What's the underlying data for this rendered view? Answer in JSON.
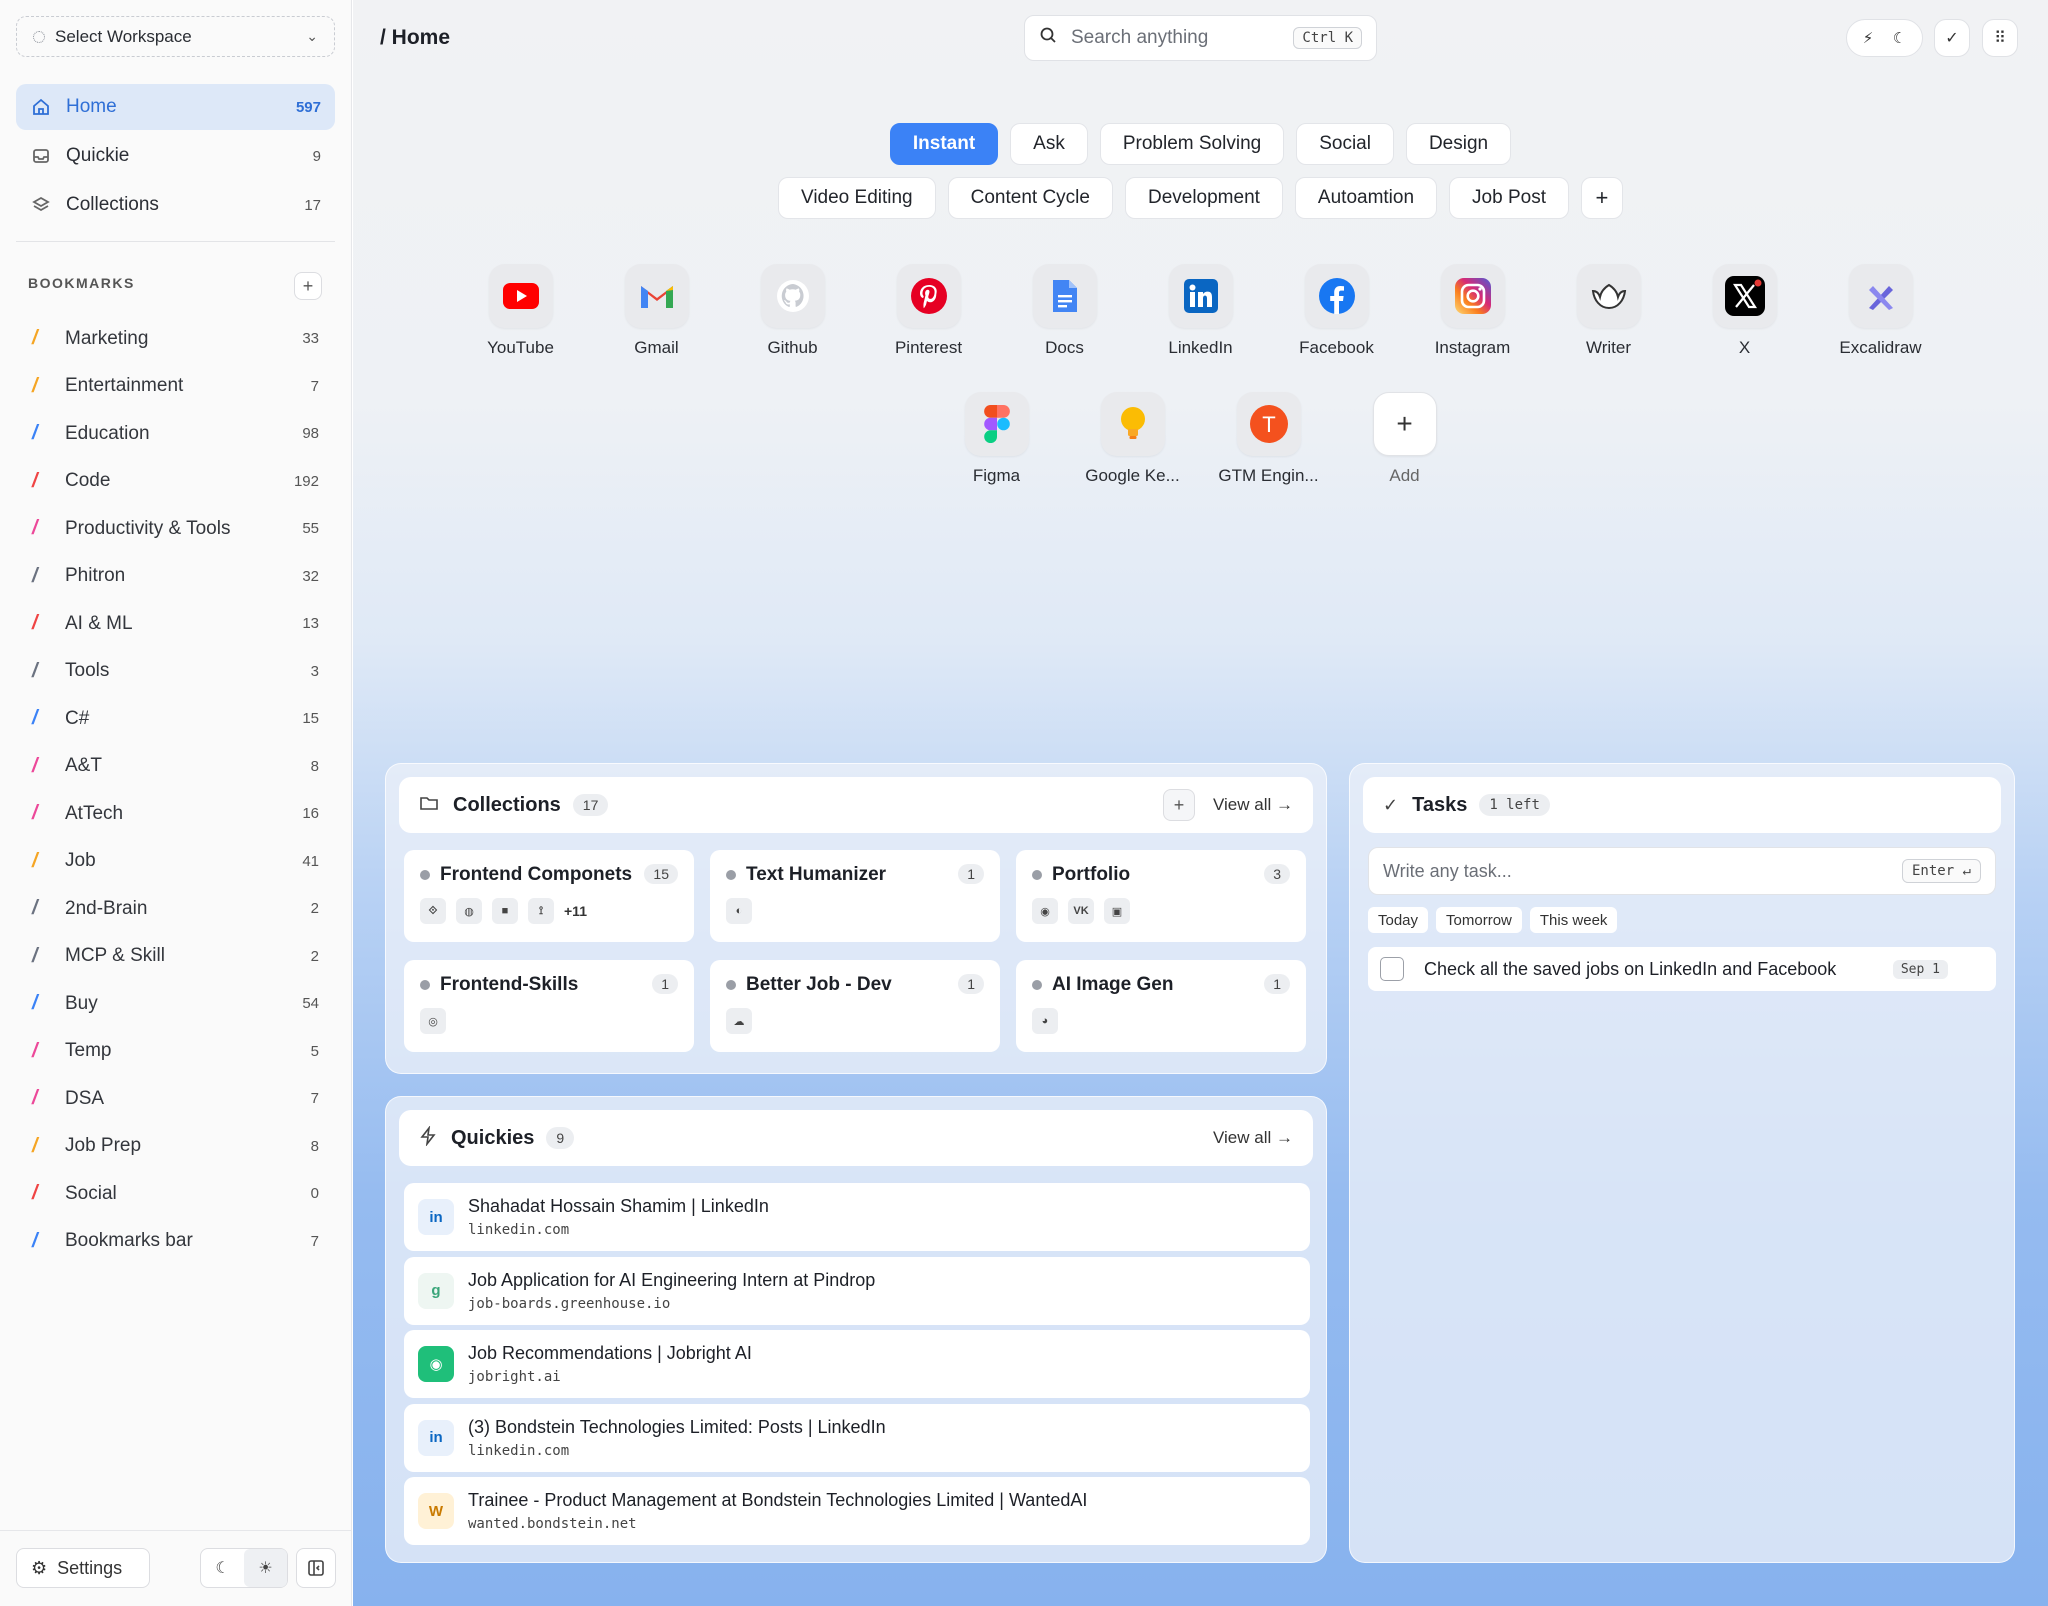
{
  "sidebar": {
    "workspace_label": "Select Workspace",
    "nav": [
      {
        "label": "Home",
        "count": "597",
        "icon": "home-icon"
      },
      {
        "label": "Quickie",
        "count": "9",
        "icon": "inbox-icon"
      },
      {
        "label": "Collections",
        "count": "17",
        "icon": "layers-icon"
      }
    ],
    "bookmarks_heading": "BOOKMARKS",
    "bookmarks": [
      {
        "label": "Marketing",
        "count": "33",
        "color": "#f5a524"
      },
      {
        "label": "Entertainment",
        "count": "7",
        "color": "#f5a524"
      },
      {
        "label": "Education",
        "count": "98",
        "color": "#3b82f6"
      },
      {
        "label": "Code",
        "count": "192",
        "color": "#ef4444"
      },
      {
        "label": "Productivity & Tools",
        "count": "55",
        "color": "#ec4899"
      },
      {
        "label": "Phitron",
        "count": "32",
        "color": "#6b7280"
      },
      {
        "label": "AI & ML",
        "count": "13",
        "color": "#ef4444"
      },
      {
        "label": "Tools",
        "count": "3",
        "color": "#6b7280"
      },
      {
        "label": "C#",
        "count": "15",
        "color": "#3b82f6"
      },
      {
        "label": "A&T",
        "count": "8",
        "color": "#ec4899"
      },
      {
        "label": "AtTech",
        "count": "16",
        "color": "#ec4899"
      },
      {
        "label": "Job",
        "count": "41",
        "color": "#f5a524"
      },
      {
        "label": "2nd-Brain",
        "count": "2",
        "color": "#6b7280"
      },
      {
        "label": "MCP & Skill",
        "count": "2",
        "color": "#6b7280"
      },
      {
        "label": "Buy",
        "count": "54",
        "color": "#3b82f6"
      },
      {
        "label": "Temp",
        "count": "5",
        "color": "#ec4899"
      },
      {
        "label": "DSA",
        "count": "7",
        "color": "#ec4899"
      },
      {
        "label": "Job Prep",
        "count": "8",
        "color": "#f5a524"
      },
      {
        "label": "Social",
        "count": "0",
        "color": "#ef4444"
      },
      {
        "label": "Bookmarks bar",
        "count": "7",
        "color": "#3b82f6"
      }
    ],
    "settings_label": "Settings"
  },
  "header": {
    "breadcrumb": "/ Home",
    "search_placeholder": "Search anything",
    "search_shortcut": "Ctrl K"
  },
  "tabs_row1": [
    {
      "label": "Instant",
      "active": true
    },
    {
      "label": "Ask"
    },
    {
      "label": "Problem Solving"
    },
    {
      "label": "Social"
    },
    {
      "label": "Design"
    }
  ],
  "tabs_row2": [
    {
      "label": "Video Editing"
    },
    {
      "label": "Content Cycle"
    },
    {
      "label": "Development"
    },
    {
      "label": "Autoamtion"
    },
    {
      "label": "Job Post"
    }
  ],
  "apps_row1": [
    {
      "label": "YouTube",
      "icon": "youtube-icon"
    },
    {
      "label": "Gmail",
      "icon": "gmail-icon"
    },
    {
      "label": "Github",
      "icon": "github-icon"
    },
    {
      "label": "Pinterest",
      "icon": "pinterest-icon"
    },
    {
      "label": "Docs",
      "icon": "docs-icon"
    },
    {
      "label": "LinkedIn",
      "icon": "linkedin-icon"
    },
    {
      "label": "Facebook",
      "icon": "facebook-icon"
    },
    {
      "label": "Instagram",
      "icon": "instagram-icon"
    },
    {
      "label": "Writer",
      "icon": "writer-icon"
    },
    {
      "label": "X",
      "icon": "x-icon"
    },
    {
      "label": "Excalidraw",
      "icon": "excalidraw-icon"
    }
  ],
  "apps_row2": [
    {
      "label": "Figma",
      "icon": "figma-icon"
    },
    {
      "label": "Google Ke...",
      "icon": "google-keep-icon"
    },
    {
      "label": "GTM Engin...",
      "icon": "gtm-engine-icon"
    }
  ],
  "add_app_label": "Add",
  "collections": {
    "title": "Collections",
    "count": "17",
    "view_all": "View all",
    "items": [
      {
        "name": "Frontend Componets",
        "count": "15",
        "more": "+11"
      },
      {
        "name": "Text Humanizer",
        "count": "1"
      },
      {
        "name": "Portfolio",
        "count": "3"
      },
      {
        "name": "Frontend-Skills",
        "count": "1"
      },
      {
        "name": "Better Job - Dev",
        "count": "1"
      },
      {
        "name": "AI Image Gen",
        "count": "1"
      }
    ]
  },
  "quickies": {
    "title": "Quickies",
    "count": "9",
    "view_all": "View all",
    "items": [
      {
        "title": "Shahadat Hossain Shamim | LinkedIn",
        "url": "linkedin.com",
        "icon": "linkedin-icon"
      },
      {
        "title": "Job Application for AI Engineering Intern at Pindrop",
        "url": "job-boards.greenhouse.io",
        "icon": "greenhouse-icon"
      },
      {
        "title": "Job Recommendations | Jobright AI",
        "url": "jobright.ai",
        "icon": "jobright-icon"
      },
      {
        "title": "(3) Bondstein Technologies Limited: Posts | LinkedIn",
        "url": "linkedin.com",
        "icon": "linkedin-icon"
      },
      {
        "title": "Trainee - Product Management at Bondstein Technologies Limited | WantedAI",
        "url": "wanted.bondstein.net",
        "icon": "wantedai-icon"
      }
    ]
  },
  "tasks": {
    "title": "Tasks",
    "badge": "1 left",
    "input_placeholder": "Write any task...",
    "enter_hint": "Enter ↵",
    "chips": [
      "Today",
      "Tomorrow",
      "This week"
    ],
    "items": [
      {
        "text": "Check all the saved jobs on LinkedIn and Facebook",
        "date": "Sep 1"
      }
    ]
  },
  "colors": {
    "accent": "#3b82f6",
    "active_nav_bg": "#dde8f8"
  }
}
